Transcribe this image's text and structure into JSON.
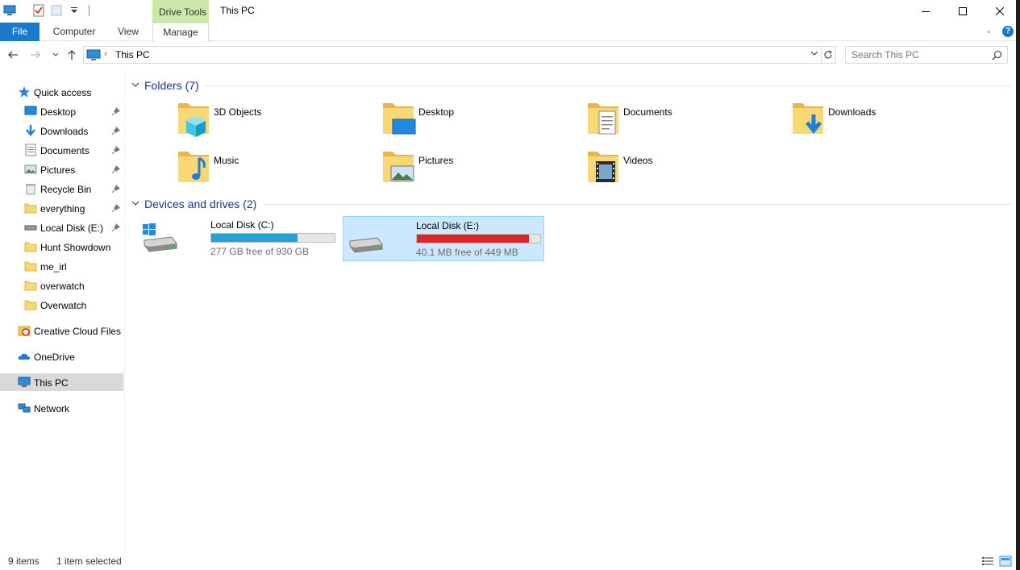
{
  "titlebar": {
    "context_tab": "Drive Tools",
    "title": "This PC"
  },
  "ribbon": {
    "tabs": [
      "File",
      "Computer",
      "View",
      "Manage"
    ],
    "help": "?"
  },
  "address": {
    "path": "This PC",
    "search_placeholder": "Search This PC"
  },
  "nav": {
    "quick_access": "Quick access",
    "quick_items": [
      {
        "label": "Desktop",
        "icon": "desktop-icon",
        "pinned": true
      },
      {
        "label": "Downloads",
        "icon": "downloads-icon",
        "pinned": true
      },
      {
        "label": "Documents",
        "icon": "documents-icon",
        "pinned": true
      },
      {
        "label": "Pictures",
        "icon": "pictures-icon",
        "pinned": true
      },
      {
        "label": "Recycle Bin",
        "icon": "recycle-bin-icon",
        "pinned": true
      },
      {
        "label": "everything",
        "icon": "folder-icon",
        "pinned": true
      },
      {
        "label": "Local Disk (E:)",
        "icon": "drive-icon",
        "pinned": true
      },
      {
        "label": "Hunt Showdown",
        "icon": "folder-icon",
        "pinned": false
      },
      {
        "label": "me_irl",
        "icon": "folder-icon",
        "pinned": false
      },
      {
        "label": "overwatch",
        "icon": "folder-icon",
        "pinned": false
      },
      {
        "label": "Overwatch",
        "icon": "folder-icon",
        "pinned": false
      }
    ],
    "creative_cloud": "Creative Cloud Files",
    "onedrive": "OneDrive",
    "this_pc": "This PC",
    "network": "Network"
  },
  "folders": {
    "header": "Folders (7)",
    "items": [
      {
        "label": "3D Objects",
        "icon": "3d-objects-icon"
      },
      {
        "label": "Desktop",
        "icon": "desktop-folder-icon"
      },
      {
        "label": "Documents",
        "icon": "documents-folder-icon"
      },
      {
        "label": "Downloads",
        "icon": "downloads-folder-icon"
      },
      {
        "label": "Music",
        "icon": "music-folder-icon"
      },
      {
        "label": "Pictures",
        "icon": "pictures-folder-icon"
      },
      {
        "label": "Videos",
        "icon": "videos-folder-icon"
      }
    ]
  },
  "drives": {
    "header": "Devices and drives (2)",
    "items": [
      {
        "label": "Local Disk (C:)",
        "free": "277 GB free of 930 GB",
        "used_fraction": 0.702,
        "bar_color": "#26a0da",
        "selected": false
      },
      {
        "label": "Local Disk (E:)",
        "free": "40.1 MB free of 449 MB",
        "used_fraction": 0.911,
        "bar_color": "#da2626",
        "selected": true
      }
    ]
  },
  "status": {
    "items": "9 items",
    "selected": "1 item selected"
  },
  "colors": {
    "accent": "#1979ca",
    "context_tab": "#cbe8a6",
    "selection": "#cce8ff",
    "group_header": "#1e3287"
  }
}
